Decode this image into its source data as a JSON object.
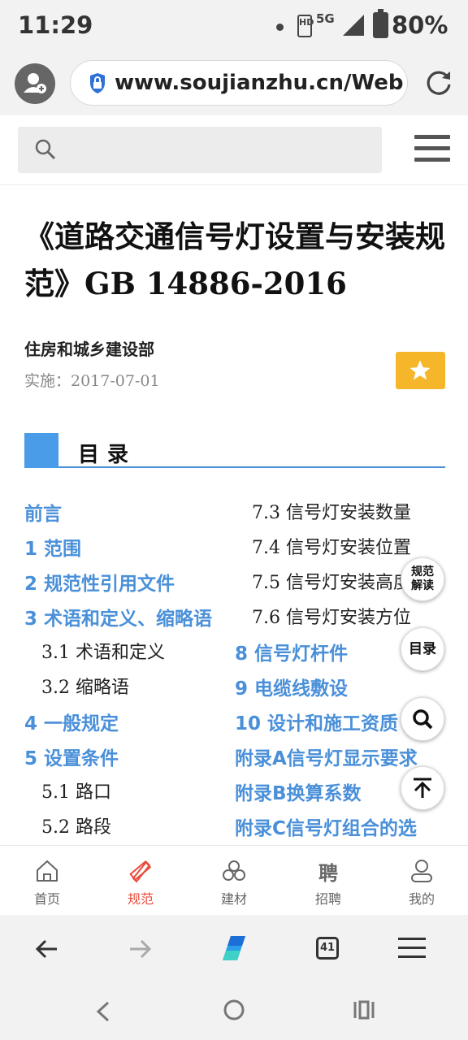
{
  "status": {
    "time": "11:29",
    "network": "5G",
    "sim": "HD",
    "battery": "80%"
  },
  "browser": {
    "url": "www.soujianzhu.cn/Web",
    "tab_count": "41"
  },
  "search": {
    "placeholder": ""
  },
  "document": {
    "title": "《道路交通信号灯设置与安装规范》GB 14886-2016",
    "publisher": "住房和城乡建设部",
    "implementation": "实施：2017-07-01"
  },
  "toc": {
    "heading": "目录",
    "left": [
      {
        "label": "前言",
        "level": "main"
      },
      {
        "label": "1 范围",
        "level": "main"
      },
      {
        "label": "2 规范性引用文件",
        "level": "main"
      },
      {
        "label": "3 术语和定义、缩略语",
        "level": "main"
      },
      {
        "label": "3.1 术语和定义",
        "level": "sub"
      },
      {
        "label": "3.2 缩略语",
        "level": "sub"
      },
      {
        "label": "4 一般规定",
        "level": "main"
      },
      {
        "label": "5 设置条件",
        "level": "main"
      },
      {
        "label": "5.1 路口",
        "level": "sub"
      },
      {
        "label": "5.2 路段",
        "level": "sub"
      }
    ],
    "right": [
      {
        "label": "7.3 信号灯安装数量",
        "level": "sub"
      },
      {
        "label": "7.4 信号灯安装位置",
        "level": "sub"
      },
      {
        "label": "7.5 信号灯安装高度",
        "level": "sub"
      },
      {
        "label": "7.6 信号灯安装方位",
        "level": "sub"
      },
      {
        "label": "8 信号灯杆件",
        "level": "main"
      },
      {
        "label": "9 电缆线敷设",
        "level": "main"
      },
      {
        "label": "10 设计和施工资质",
        "level": "main"
      },
      {
        "label": "附录A信号灯显示要求",
        "level": "main"
      },
      {
        "label": "附录B换算系数",
        "level": "main"
      },
      {
        "label": "附录C信号灯组合的选",
        "level": "main"
      }
    ]
  },
  "fabs": {
    "interpret_line1": "规范",
    "interpret_line2": "解读",
    "toc": "目录"
  },
  "sitenav": [
    {
      "label": "首页",
      "icon": "home-icon"
    },
    {
      "label": "规范",
      "icon": "ruler-pencil-icon",
      "active": true
    },
    {
      "label": "建材",
      "icon": "materials-icon"
    },
    {
      "label": "招聘",
      "icon": "recruit-glyph-icon",
      "glyph": "聘"
    },
    {
      "label": "我的",
      "icon": "user-icon"
    }
  ],
  "colors": {
    "accent": "#4a90d9",
    "active": "#e94b3c",
    "star": "#f5b62a"
  }
}
